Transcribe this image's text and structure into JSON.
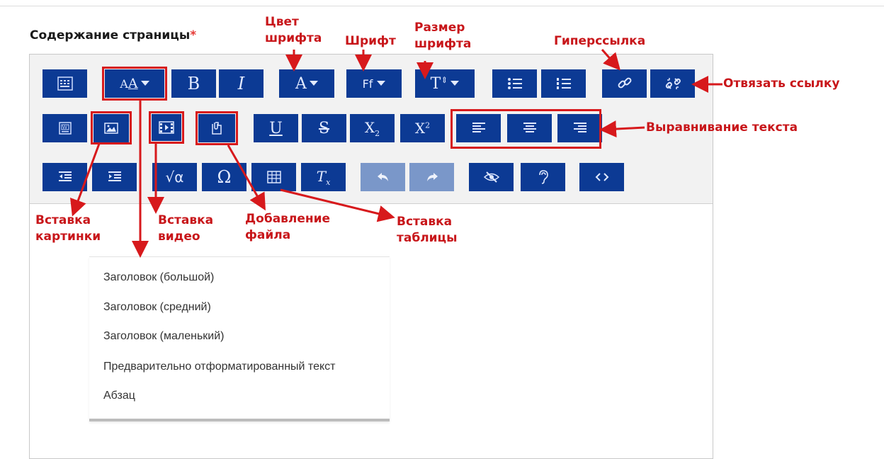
{
  "form": {
    "label": "Содержание страницы",
    "required_mark": "*"
  },
  "toolbar": {
    "row1": [
      {
        "name": "show-more-buttons",
        "icon": "toolbar-toggle-icon"
      },
      {
        "name": "paragraph-styles",
        "icon": "paragraph-styles-icon",
        "glyph": "A̲A"
      },
      {
        "name": "bold",
        "icon": "bold-icon",
        "glyph": "B"
      },
      {
        "name": "italic",
        "icon": "italic-icon",
        "glyph": "I"
      },
      {
        "name": "font-color",
        "icon": "font-color-icon",
        "glyph": "A"
      },
      {
        "name": "font-family",
        "icon": "font-family-icon",
        "glyph": "Ff"
      },
      {
        "name": "font-size",
        "icon": "font-size-icon",
        "glyph": "T"
      },
      {
        "name": "unordered-list",
        "icon": "bullet-list-icon"
      },
      {
        "name": "ordered-list",
        "icon": "numbered-list-icon"
      },
      {
        "name": "link",
        "icon": "link-icon"
      },
      {
        "name": "unlink",
        "icon": "unlink-icon"
      }
    ],
    "row2": [
      {
        "name": "paste-from-word",
        "icon": "word-paste-icon"
      },
      {
        "name": "insert-image",
        "icon": "image-icon"
      },
      {
        "name": "insert-media",
        "icon": "media-icon"
      },
      {
        "name": "insert-file",
        "icon": "file-icon"
      },
      {
        "name": "underline",
        "icon": "underline-icon",
        "glyph": "U"
      },
      {
        "name": "strikethrough",
        "icon": "strikethrough-icon",
        "glyph": "S"
      },
      {
        "name": "subscript",
        "icon": "subscript-icon",
        "glyph": "X₂"
      },
      {
        "name": "superscript",
        "icon": "superscript-icon",
        "glyph": "X²"
      },
      {
        "name": "align-left",
        "icon": "align-left-icon"
      },
      {
        "name": "align-center",
        "icon": "align-center-icon"
      },
      {
        "name": "align-right",
        "icon": "align-right-icon"
      }
    ],
    "row3": [
      {
        "name": "outdent",
        "icon": "outdent-icon"
      },
      {
        "name": "indent",
        "icon": "indent-icon"
      },
      {
        "name": "equation",
        "icon": "equation-icon",
        "glyph": "√α"
      },
      {
        "name": "special-character",
        "icon": "omega-icon",
        "glyph": "Ω"
      },
      {
        "name": "table",
        "icon": "table-icon"
      },
      {
        "name": "clear-formatting",
        "icon": "clear-formatting-icon",
        "glyph": "T"
      },
      {
        "name": "undo",
        "icon": "undo-icon",
        "disabled": true
      },
      {
        "name": "redo",
        "icon": "redo-icon",
        "disabled": true
      },
      {
        "name": "accessibility-checker",
        "icon": "eye-slash-icon"
      },
      {
        "name": "screenreader-helper",
        "icon": "ear-icon"
      },
      {
        "name": "html-source",
        "icon": "code-icon"
      }
    ]
  },
  "annotations": {
    "font_color": [
      "Цвет",
      "шрифта"
    ],
    "font": "Шрифт",
    "font_size": [
      "Размер",
      "шрифта"
    ],
    "hyperlink": "Гиперссылка",
    "unlink": "Отвязать ссылку",
    "alignment": "Выравнивание текста",
    "insert_image": [
      "Вставка",
      "картинки"
    ],
    "insert_video": [
      "Вставка",
      "видео"
    ],
    "add_file": [
      "Добавление",
      "файла"
    ],
    "insert_table": [
      "Вставка",
      "таблицы"
    ]
  },
  "paragraph_menu": {
    "items": [
      "Заголовок (большой)",
      "Заголовок (средний)",
      "Заголовок (маленький)",
      "Предварительно отформатированный текст",
      "Абзац"
    ]
  },
  "colors": {
    "button": "#0c3a94",
    "button_disabled": "#7a97c9",
    "annotation_red": "#c8161a"
  }
}
